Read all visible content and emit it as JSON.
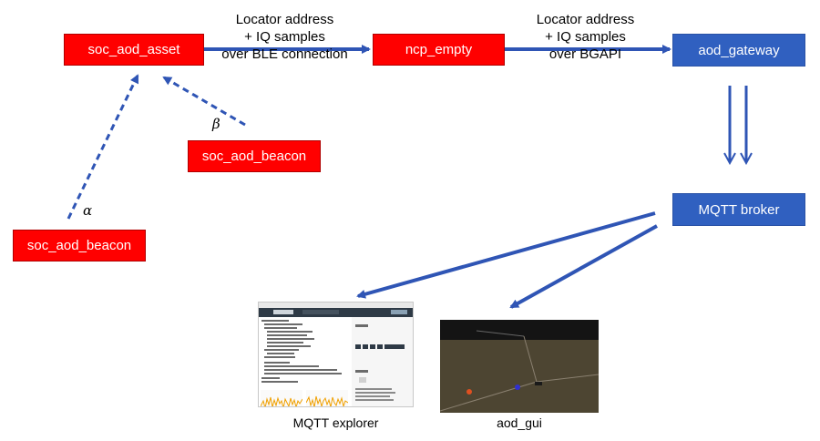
{
  "nodes": {
    "soc_aod_asset": "soc_aod_asset",
    "ncp_empty": "ncp_empty",
    "aod_gateway": "aod_gateway",
    "soc_aod_beacon_beta": "soc_aod_beacon",
    "soc_aod_beacon_alpha": "soc_aod_beacon",
    "mqtt_broker": "MQTT broker"
  },
  "edge_labels": {
    "asset_to_ncp": [
      "Locator address",
      "+ IQ samples",
      "over BLE connection"
    ],
    "ncp_to_gateway": [
      "Locator address",
      "+ IQ samples",
      "over BGAPI"
    ]
  },
  "greek": {
    "beta": "β",
    "alpha": "α"
  },
  "captions": {
    "explorer": "MQTT explorer",
    "gui": "aod_gui"
  },
  "colors": {
    "red": "#ff0000",
    "blue": "#3060c0",
    "arrow": "#2f55b5"
  }
}
